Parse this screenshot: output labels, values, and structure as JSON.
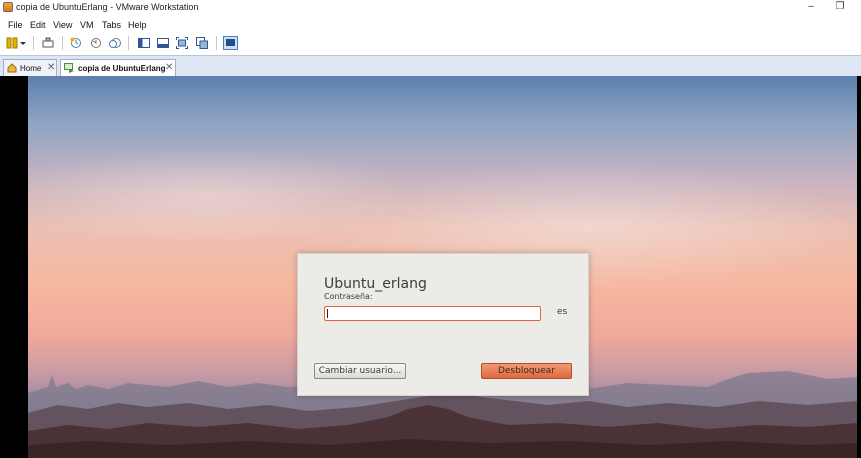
{
  "window": {
    "title": "copia de UbuntuErlang - VMware Workstation",
    "minimize_glyph": "–",
    "restore_glyph": "❐"
  },
  "menu": {
    "items": [
      "File",
      "Edit",
      "View",
      "VM",
      "Tabs",
      "Help"
    ]
  },
  "toolbar": {
    "icons": [
      "pause-icon",
      "dropdown-arrow-icon",
      "send-ctrl-alt-del-icon",
      "snapshot-icon",
      "revert-snapshot-icon",
      "snapshot-manager-icon",
      "show-library-icon",
      "thumbnail-bar-icon",
      "full-screen-icon",
      "unity-icon",
      "console-view-icon"
    ]
  },
  "tabs": [
    {
      "label": "Home",
      "icon": "home-icon",
      "active": false
    },
    {
      "label": "copia de UbuntuErlang",
      "icon": "vm-icon",
      "active": true
    }
  ],
  "tab_close_glyph": "✕",
  "login": {
    "username": "Ubuntu_erlang",
    "password_label": "Contraseña:",
    "password_value": "",
    "keyboard_layout": "es",
    "switch_user_button": "Cambiar usuario...",
    "unlock_button": "Desbloquear"
  },
  "colors": {
    "accent_orange": "#e2673a",
    "tab_strip": "#dde6f2",
    "dialog_bg": "#ecebe8"
  }
}
